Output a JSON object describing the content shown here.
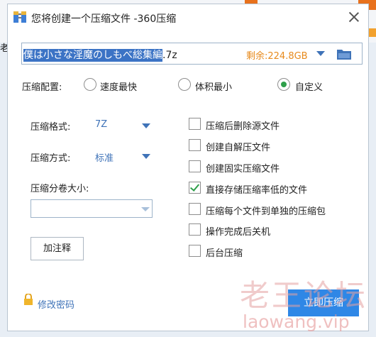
{
  "background": {
    "partial_text": "老"
  },
  "dialog": {
    "title": "您将创建一个压缩文件 -360压缩",
    "app_icon": "archive-icon",
    "close_icon": "close-icon"
  },
  "path": {
    "selected_part": "僕は小さな淫魔のしもべ総集編",
    "rest": ".7z",
    "space_label": "剩余:224.8GB"
  },
  "config": {
    "label": "压缩配置:",
    "options": [
      "速度最快",
      "体积最小",
      "自定义"
    ],
    "selected_index": 2
  },
  "format": {
    "label": "压缩格式:",
    "value": "7Z"
  },
  "method": {
    "label": "压缩方式:",
    "value": "标准"
  },
  "volume": {
    "label": "压缩分卷大小:",
    "value": ""
  },
  "comment_button": "加注释",
  "checkboxes": [
    {
      "label": "压缩后删除源文件",
      "checked": false
    },
    {
      "label": "创建自解压文件",
      "checked": false
    },
    {
      "label": "创建固实压缩文件",
      "checked": false
    },
    {
      "label": "直接存储压缩率低的文件",
      "checked": true
    },
    {
      "label": "压缩每个文件到单独的压缩包",
      "checked": false
    },
    {
      "label": "操作完成后关机",
      "checked": false
    },
    {
      "label": "后台压缩",
      "checked": false
    }
  ],
  "password_link": "修改密码",
  "primary_button": "立即压缩",
  "watermark": {
    "line1": "老王论坛",
    "line2": "laowang.vip"
  },
  "colors": {
    "accent": "#3f73b8",
    "primary": "#2f87e6",
    "check": "#2e9f4a",
    "space": "#e78a1c"
  }
}
